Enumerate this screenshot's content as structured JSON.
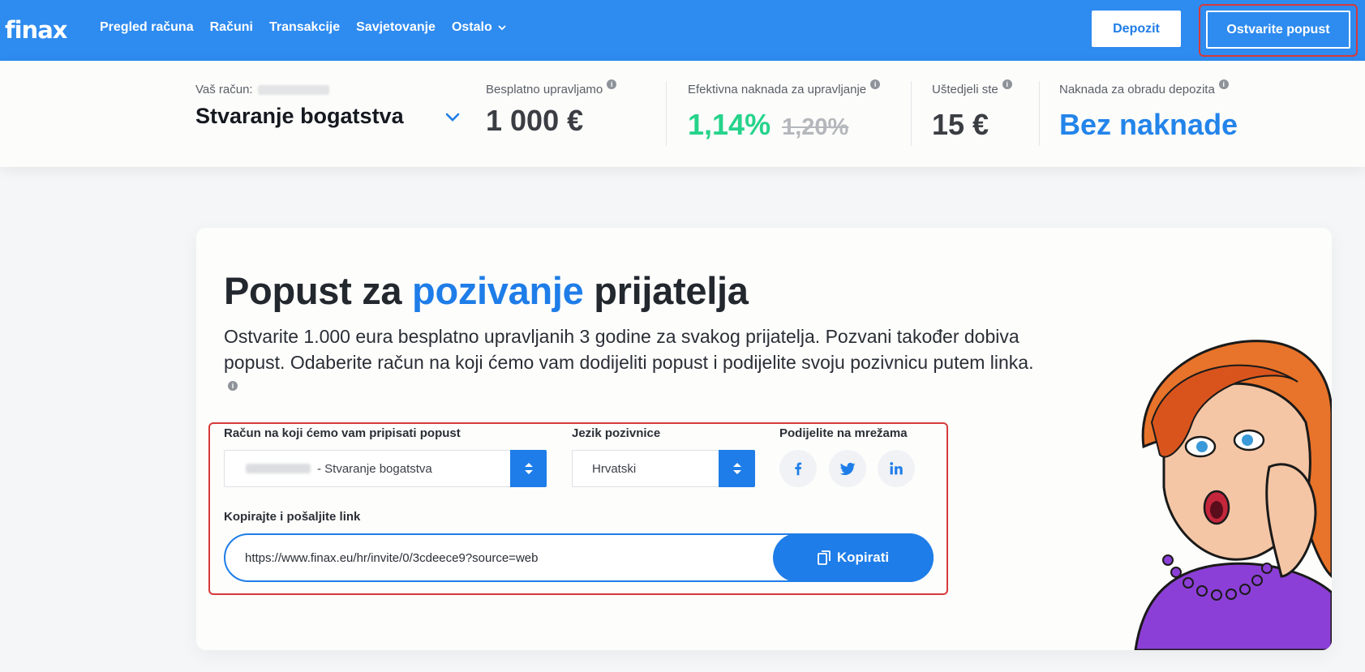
{
  "brand": {
    "logo": "finax",
    "primary": "#2e8bef",
    "accent_green": "#25d38a"
  },
  "nav": {
    "items": [
      "Pregled računa",
      "Računi",
      "Transakcije",
      "Savjetovanje"
    ],
    "more_label": "Ostalo"
  },
  "header_buttons": {
    "deposit": "Depozit",
    "discount": "Ostvarite popust"
  },
  "summary": {
    "account_label": "Vaš račun:",
    "account_name": "Stvaranje bogatstva",
    "free_managed_label": "Besplatno upravljamo",
    "free_managed_value": "1 000 €",
    "effective_fee_label": "Efektivna naknada za upravljanje",
    "effective_fee_value": "1,14%",
    "effective_fee_old": "1,20%",
    "saved_label": "Uštedjeli ste",
    "saved_value": "15 €",
    "deposit_fee_label": "Naknada za obradu depozita",
    "deposit_fee_value": "Bez naknade"
  },
  "referral": {
    "title_part1": "Popust za ",
    "title_accent": "pozivanje",
    "title_part2": " prijatelja",
    "description": "Ostvarite 1.000 eura besplatno upravljanih 3 godine za svakog prijatelja. Pozvani također dobiva popust. Odaberite račun na koji ćemo vam dodijeliti popust i podijelite svoju pozivnicu putem linka.",
    "account_select_label": "Račun na koji ćemo vam pripisati popust",
    "account_select_value": "- Stvaranje bogatstva",
    "language_label": "Jezik pozivnice",
    "language_value": "Hrvatski",
    "share_label": "Podijelite na mrežama",
    "copy_label": "Kopirajte i pošaljite link",
    "link_value": "https://www.finax.eu/hr/invite/0/3cdeece9?source=web",
    "copy_button": "Kopirati"
  },
  "social_icons": [
    "facebook-icon",
    "twitter-icon",
    "linkedin-icon"
  ]
}
